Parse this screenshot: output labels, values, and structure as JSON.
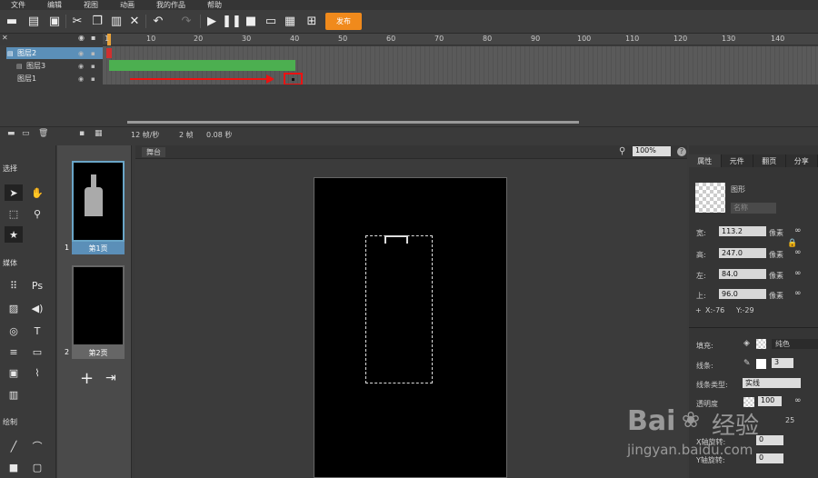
{
  "menu": [
    "文件",
    "编辑",
    "视图",
    "动画",
    "我的作品",
    "帮助"
  ],
  "toolbar": {
    "publish": "发布"
  },
  "timeline": {
    "ticks": [
      "1",
      "10",
      "20",
      "30",
      "40",
      "50",
      "60",
      "70",
      "80",
      "90",
      "100",
      "110",
      "120",
      "130",
      "140"
    ],
    "layers": [
      "图层2",
      "图层3",
      "图层1"
    ],
    "fps": "12 帧/秒",
    "frames": "2 帧",
    "seconds": "0.08 秒"
  },
  "tools": {
    "select": "选择",
    "media": "媒体",
    "draw": "绘制",
    "ps": "Ps",
    "text": "T"
  },
  "pages": [
    {
      "label": "第1页",
      "num": "1"
    },
    {
      "label": "第2页",
      "num": "2"
    }
  ],
  "stage": {
    "tab": "舞台",
    "zoom": "100%"
  },
  "props": {
    "tabs": [
      "属性",
      "元件",
      "翻页",
      "分享"
    ],
    "shape": "图形",
    "name_ph": "名称",
    "w_label": "宽:",
    "w": "113.2",
    "h_label": "高:",
    "h": "247.0",
    "l_label": "左:",
    "l": "84.0",
    "t_label": "上:",
    "t": "96.0",
    "unit": "像素",
    "x": "X:-76",
    "y": "Y:-29",
    "fill_label": "填充:",
    "fill_type": "纯色",
    "stroke_label": "线条:",
    "stroke_w": "3",
    "stroke_type_label": "线条类型:",
    "stroke_type": "实线",
    "opacity_label": "透明度",
    "opacity": "100",
    "radius": "25",
    "xrot_label": "X轴旋转:",
    "yrot_label": "Y轴旋转:",
    "rot_val": "0"
  },
  "watermark": {
    "brand": "Bai",
    "brand2": "经验",
    "url": "jingyan.baidu.com"
  }
}
